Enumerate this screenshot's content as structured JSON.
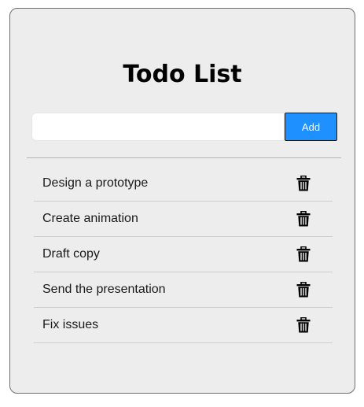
{
  "app": {
    "title": "Todo List"
  },
  "form": {
    "input_value": "",
    "input_placeholder": "",
    "add_label": "Add"
  },
  "todos": [
    {
      "text": "Design a prototype",
      "icon": "trash-icon"
    },
    {
      "text": "Create animation",
      "icon": "trash-icon"
    },
    {
      "text": "Draft copy",
      "icon": "trash-icon"
    },
    {
      "text": "Send the presentation",
      "icon": "trash-icon"
    },
    {
      "text": "Fix issues",
      "icon": "trash-icon"
    }
  ],
  "colors": {
    "accent": "#1e90ff",
    "card_background": "#ededed",
    "icon": "#000000"
  }
}
